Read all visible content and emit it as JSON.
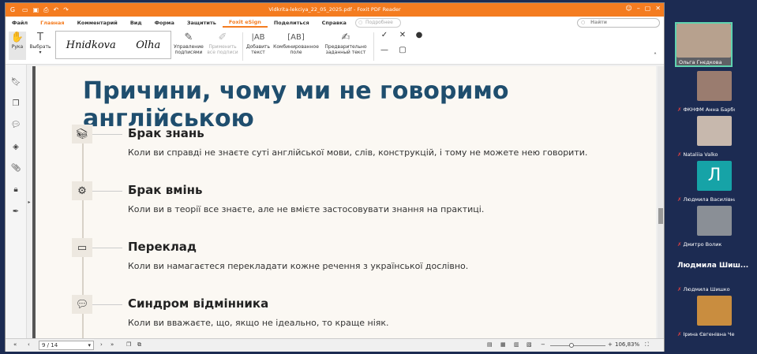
{
  "app": {
    "title": "Vidkrita-lekciya_22_05_2025.pdf - Foxit PDF Reader",
    "logo_icon": "foxit-logo-icon"
  },
  "menu": {
    "items": [
      "Файл",
      "Главная",
      "Комментарий",
      "Вид",
      "Форма",
      "Защитить",
      "Foxit eSign",
      "Поделиться",
      "Справка"
    ],
    "help_placeholder": "Подробнее",
    "search_placeholder": "Найти"
  },
  "ribbon": {
    "hand": "Рука",
    "select": "Выбрать",
    "signature_name": "Hnidkova",
    "signature_name2": "Olha",
    "manage_signatures": "Управление подписями",
    "apply_all": "Применить все подписи",
    "add_text": "Добавить текст",
    "combo_field": "Комбинированное поле",
    "predefined_text": "Предварительно заданный текст"
  },
  "slide": {
    "heading": "Причини, чому ми не говоримо англійською",
    "items": [
      {
        "icon": "books-icon",
        "title": "Брак знань",
        "desc": "Коли ви справді не знаєте суті англійської мови, слів, конструкцій, і тому не можете нею говорити."
      },
      {
        "icon": "skills-icon",
        "title": "Брак вмінь",
        "desc": "Коли ви в теорії все знаєте, але не вмієте застосовувати знання на практиці."
      },
      {
        "icon": "translate-icon",
        "title": "Переклад",
        "desc": "Коли ви намагаєтеся перекладати кожне речення з української дослівно."
      },
      {
        "icon": "speech-bubble-icon",
        "title": "Синдром відмінника",
        "desc": "Коли ви вважаєте, що, якщо не ідеально, то краще ніяк."
      }
    ]
  },
  "status": {
    "page": "9 / 14",
    "zoom": "106,83%"
  },
  "participants": [
    {
      "name": "Ольга Гнєдкова",
      "muted": false
    },
    {
      "name": "ФКНФМ Анна Барболіна",
      "muted": true
    },
    {
      "name": "Nataliia Valko",
      "muted": true
    },
    {
      "name": "Людмила Василівна К",
      "muted": true,
      "initial": "Л"
    },
    {
      "name": "Дмитро Волик",
      "muted": true
    },
    {
      "name": "Людмила Шишко",
      "muted": true,
      "big": "Людмила Шиш..."
    },
    {
      "name": "Ірина Євгенівна Черн",
      "muted": true
    }
  ]
}
